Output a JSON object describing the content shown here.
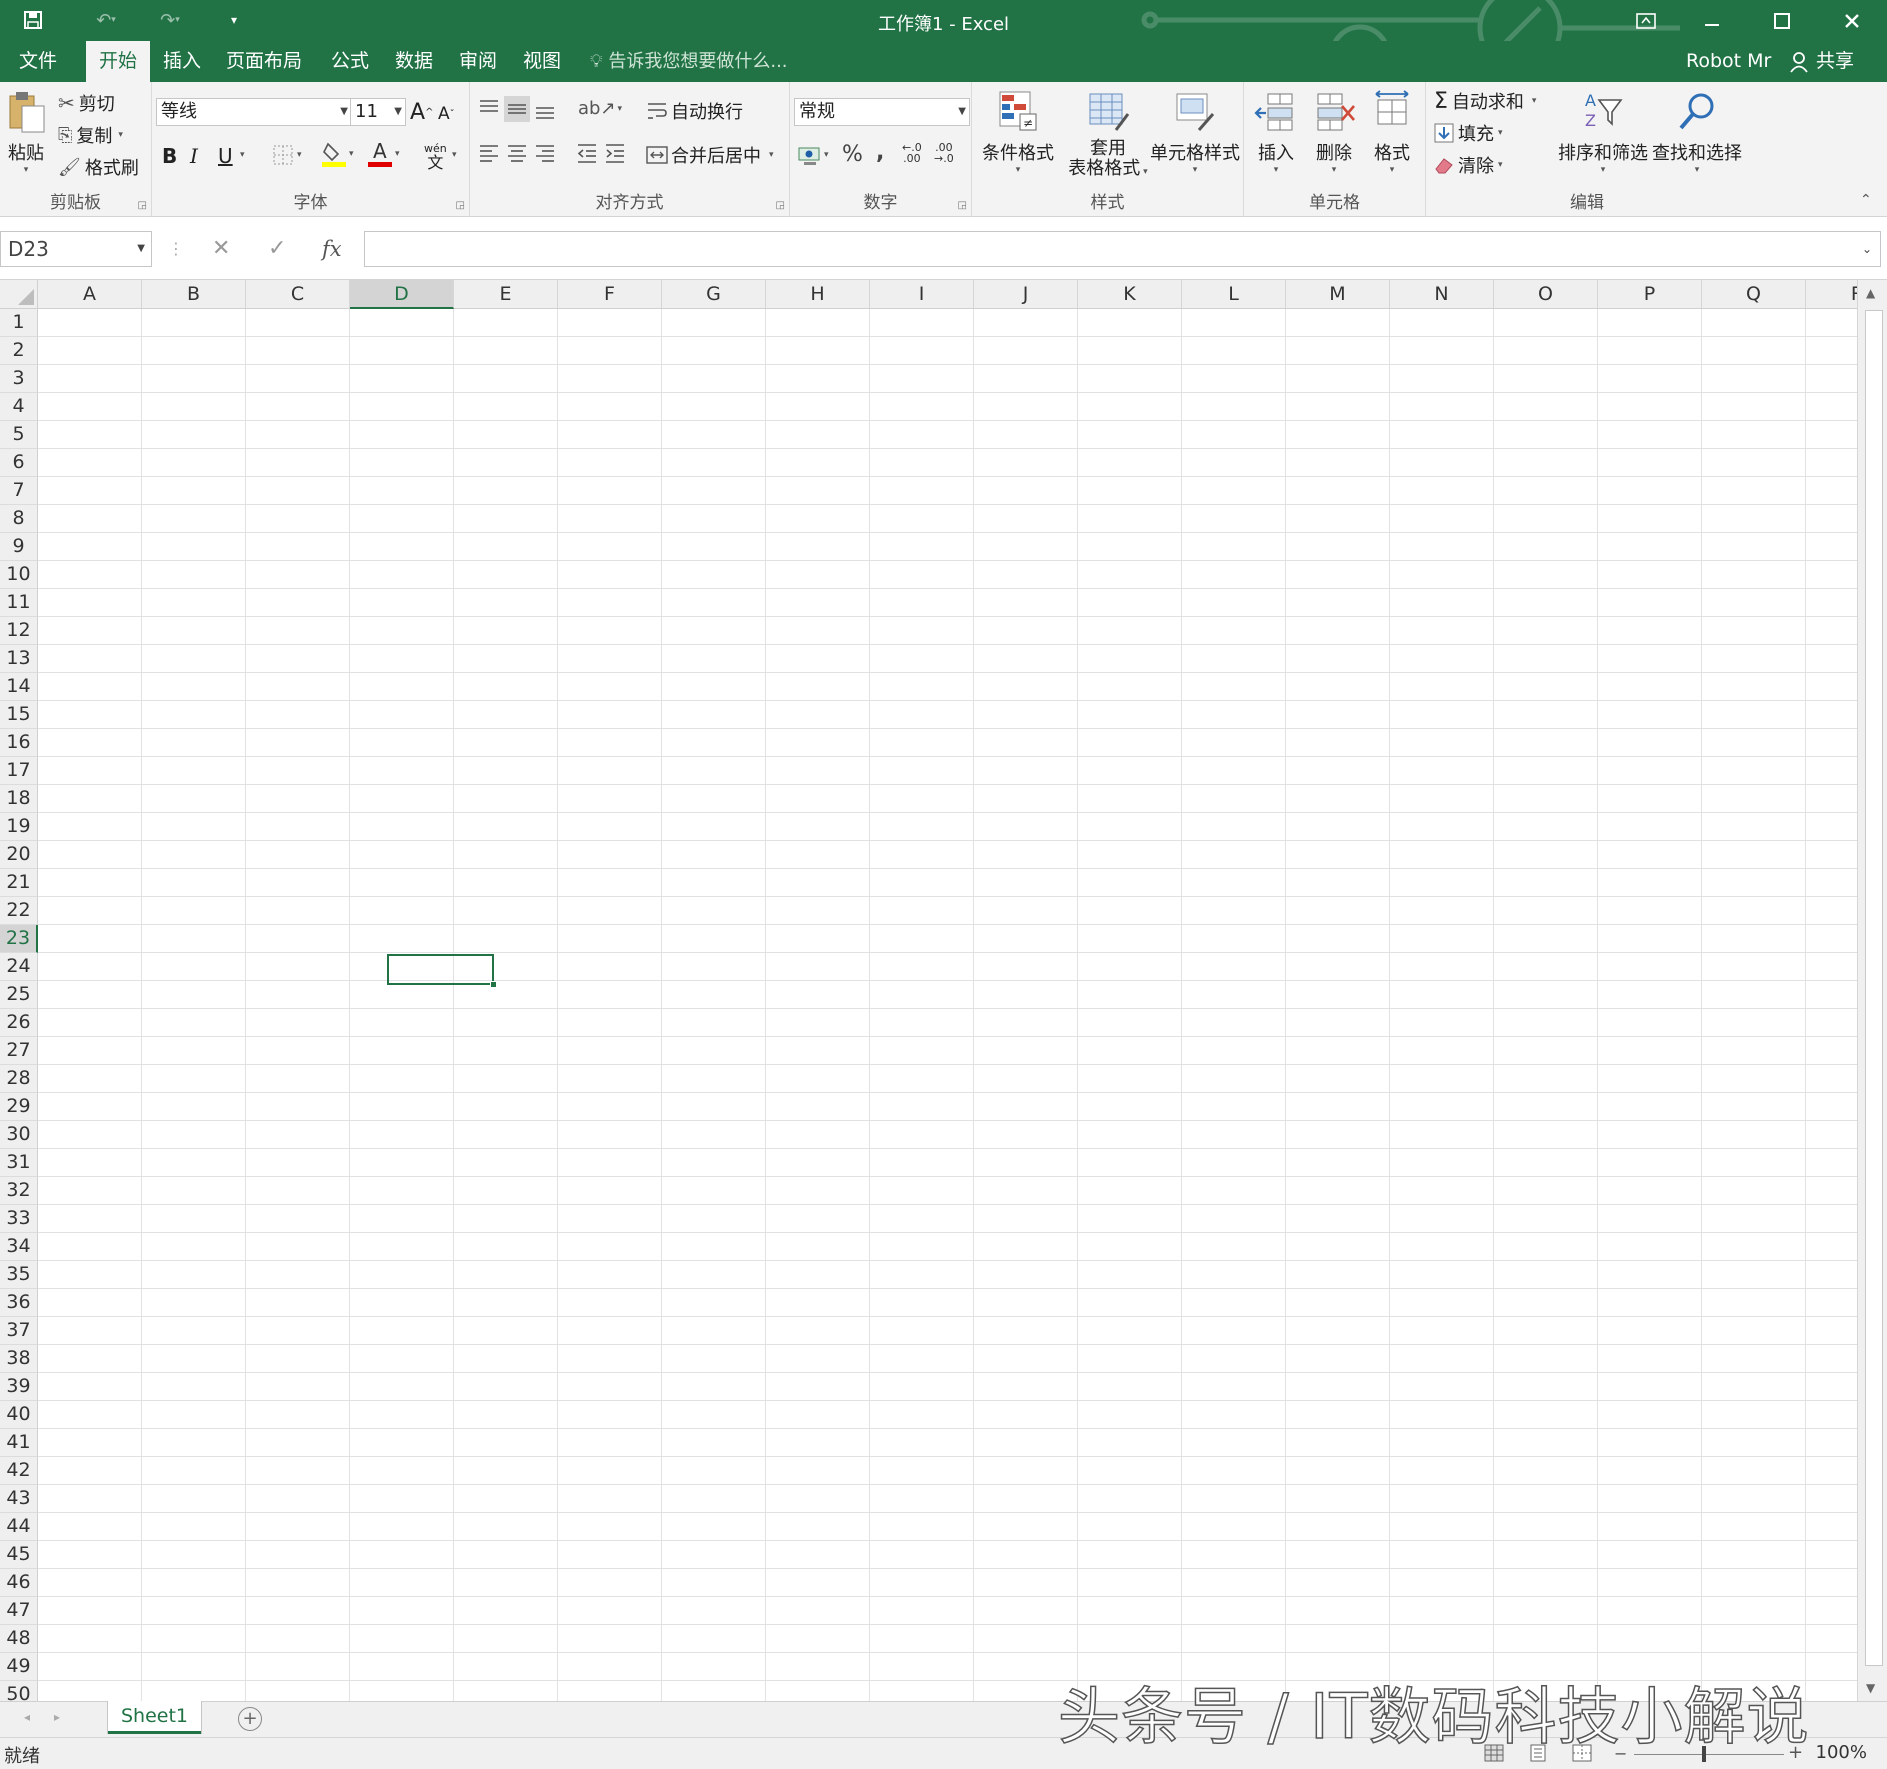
{
  "window": {
    "title": "工作簿1 - Excel"
  },
  "tabs": [
    {
      "label": "文件"
    },
    {
      "label": "开始",
      "active": true
    },
    {
      "label": "插入"
    },
    {
      "label": "页面布局"
    },
    {
      "label": "公式"
    },
    {
      "label": "数据"
    },
    {
      "label": "审阅"
    },
    {
      "label": "视图"
    }
  ],
  "tellme": {
    "placeholder": "告诉我您想要做什么..."
  },
  "user": {
    "name": "Robot Mr",
    "share_label": "共享"
  },
  "ribbon": {
    "clipboard": {
      "label": "剪贴板",
      "paste": "粘贴",
      "cut": "剪切",
      "copy": "复制",
      "format_painter": "格式刷"
    },
    "font": {
      "label": "字体",
      "font_name": "等线",
      "font_size": "11",
      "bold": "B",
      "italic": "I",
      "underline": "U",
      "phonetic": "wén"
    },
    "alignment": {
      "label": "对齐方式",
      "wrap_text": "自动换行",
      "merge_center": "合并后居中"
    },
    "number": {
      "label": "数字",
      "format": "常规"
    },
    "styles": {
      "label": "样式",
      "conditional": "条件格式",
      "table_format_line1": "套用",
      "table_format_line2": "表格格式",
      "cell_styles": "单元格样式"
    },
    "cells": {
      "label": "单元格",
      "insert": "插入",
      "delete": "删除",
      "format": "格式"
    },
    "editing": {
      "label": "编辑",
      "autosum": "自动求和",
      "fill": "填充",
      "clear": "清除",
      "sort_filter": "排序和筛选",
      "find_select": "查找和选择"
    }
  },
  "formula_bar": {
    "name_box": "D23",
    "fx": "fx",
    "value": ""
  },
  "grid": {
    "columns": [
      "A",
      "B",
      "C",
      "D",
      "E",
      "F",
      "G",
      "H",
      "I",
      "J",
      "K",
      "L",
      "M",
      "N",
      "O",
      "P",
      "Q",
      "R"
    ],
    "selected_column": "D",
    "selected_row": "23",
    "rows": [
      "1",
      "2",
      "3",
      "4",
      "5",
      "6",
      "7",
      "8",
      "9",
      "10",
      "11",
      "12",
      "13",
      "14",
      "15",
      "16",
      "17",
      "18",
      "19",
      "20",
      "21",
      "22",
      "23",
      "24",
      "25",
      "26",
      "27",
      "28",
      "29",
      "30",
      "31",
      "32",
      "33",
      "34",
      "35",
      "36",
      "37",
      "38",
      "39",
      "40",
      "41",
      "42",
      "43",
      "44",
      "45",
      "46",
      "47",
      "48",
      "49",
      "50"
    ]
  },
  "sheets": [
    {
      "name": "Sheet1",
      "active": true
    }
  ],
  "status": {
    "ready": "就绪",
    "zoom": "100%"
  },
  "watermark": "头条号 / IT数码科技小解说",
  "colors": {
    "accent": "#217346",
    "ribbon_bg": "#f3f3f3",
    "grid_line": "#e1e1e1"
  }
}
